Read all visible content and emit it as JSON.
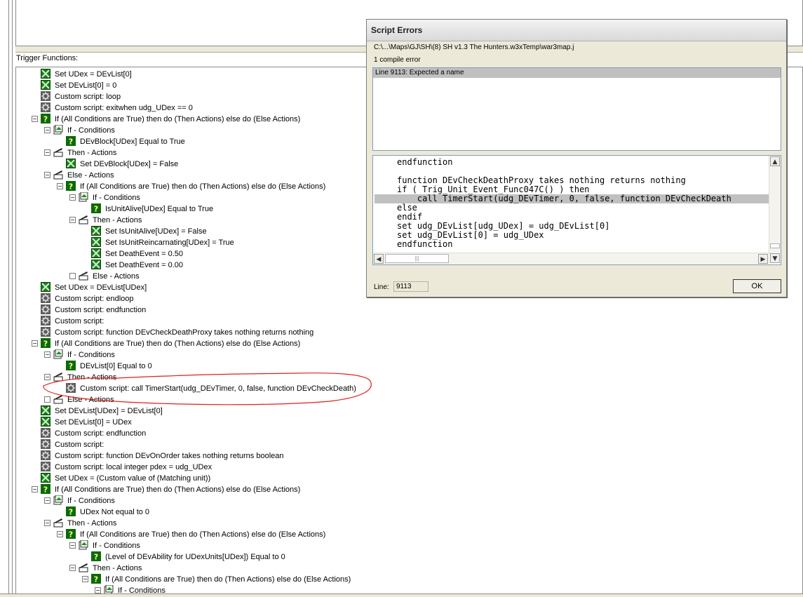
{
  "editor": {
    "trigger_functions_label": "Trigger Functions:",
    "rows": [
      {
        "text": "Set UDex = DEvList[0]",
        "icon": "set-variable-icon",
        "depth": 0,
        "exp": ""
      },
      {
        "text": "Set DEvList[0] = 0",
        "icon": "set-variable-icon",
        "depth": 0,
        "exp": ""
      },
      {
        "text": "Custom script:       loop",
        "icon": "custom-script-icon",
        "depth": 0,
        "exp": ""
      },
      {
        "text": "Custom script:           exitwhen udg_UDex == 0",
        "icon": "custom-script-icon",
        "depth": 0,
        "exp": ""
      },
      {
        "text": "If (All Conditions are True) then do (Then Actions) else do (Else Actions)",
        "icon": "if-then-else-icon",
        "depth": 0,
        "exp": "-"
      },
      {
        "text": "If - Conditions",
        "icon": "conditions-icon",
        "depth": 1,
        "exp": "-"
      },
      {
        "text": "DEvBlock[UDex] Equal to True",
        "icon": "condition-icon",
        "depth": 2,
        "exp": ""
      },
      {
        "text": "Then - Actions",
        "icon": "actions-icon",
        "depth": 1,
        "exp": "-"
      },
      {
        "text": "Set DEvBlock[UDex] = False",
        "icon": "set-variable-icon",
        "depth": 2,
        "exp": ""
      },
      {
        "text": "Else - Actions",
        "icon": "actions-icon",
        "depth": 1,
        "exp": "-"
      },
      {
        "text": "If (All Conditions are True) then do (Then Actions) else do (Else Actions)",
        "icon": "if-then-else-icon",
        "depth": 2,
        "exp": "-"
      },
      {
        "text": "If - Conditions",
        "icon": "conditions-icon",
        "depth": 3,
        "exp": "-"
      },
      {
        "text": "IsUnitAlive[UDex] Equal to True",
        "icon": "condition-icon",
        "depth": 4,
        "exp": ""
      },
      {
        "text": "Then - Actions",
        "icon": "actions-icon",
        "depth": 3,
        "exp": "-"
      },
      {
        "text": "Set IsUnitAlive[UDex] = False",
        "icon": "set-variable-icon",
        "depth": 4,
        "exp": ""
      },
      {
        "text": "Set IsUnitReincarnating[UDex] = True",
        "icon": "set-variable-icon",
        "depth": 4,
        "exp": ""
      },
      {
        "text": "Set DeathEvent = 0.50",
        "icon": "set-variable-icon",
        "depth": 4,
        "exp": ""
      },
      {
        "text": "Set DeathEvent = 0.00",
        "icon": "set-variable-icon",
        "depth": 4,
        "exp": ""
      },
      {
        "text": "Else - Actions",
        "icon": "actions-icon",
        "depth": 3,
        "exp": " "
      },
      {
        "text": "Set UDex = DEvList[UDex]",
        "icon": "set-variable-icon",
        "depth": 0,
        "exp": ""
      },
      {
        "text": "Custom script:       endloop",
        "icon": "custom-script-icon",
        "depth": 0,
        "exp": ""
      },
      {
        "text": "Custom script:   endfunction",
        "icon": "custom-script-icon",
        "depth": 0,
        "exp": ""
      },
      {
        "text": "Custom script:",
        "icon": "custom-script-icon",
        "depth": 0,
        "exp": ""
      },
      {
        "text": "Custom script:   function DEvCheckDeathProxy takes nothing returns nothing",
        "icon": "custom-script-icon",
        "depth": 0,
        "exp": ""
      },
      {
        "text": "If (All Conditions are True) then do (Then Actions) else do (Else Actions)",
        "icon": "if-then-else-icon",
        "depth": 0,
        "exp": "-"
      },
      {
        "text": "If - Conditions",
        "icon": "conditions-icon",
        "depth": 1,
        "exp": "-"
      },
      {
        "text": "DEvList[0] Equal to 0",
        "icon": "condition-icon",
        "depth": 2,
        "exp": ""
      },
      {
        "text": "Then - Actions",
        "icon": "actions-icon",
        "depth": 1,
        "exp": "-"
      },
      {
        "text": "Custom script:    call TimerStart(udg_DEvTimer, 0, false, function DEvCheckDeath)",
        "icon": "custom-script-icon",
        "depth": 2,
        "exp": ""
      },
      {
        "text": "Else - Actions",
        "icon": "actions-icon",
        "depth": 1,
        "exp": " "
      },
      {
        "text": "Set DEvList[UDex] = DEvList[0]",
        "icon": "set-variable-icon",
        "depth": 0,
        "exp": ""
      },
      {
        "text": "Set DEvList[0] = UDex",
        "icon": "set-variable-icon",
        "depth": 0,
        "exp": ""
      },
      {
        "text": "Custom script:   endfunction",
        "icon": "custom-script-icon",
        "depth": 0,
        "exp": ""
      },
      {
        "text": "Custom script:",
        "icon": "custom-script-icon",
        "depth": 0,
        "exp": ""
      },
      {
        "text": "Custom script:   function DEvOnOrder takes nothing returns boolean",
        "icon": "custom-script-icon",
        "depth": 0,
        "exp": ""
      },
      {
        "text": "Custom script:       local integer pdex = udg_UDex",
        "icon": "custom-script-icon",
        "depth": 0,
        "exp": ""
      },
      {
        "text": "Set UDex = (Custom value of (Matching unit))",
        "icon": "set-variable-icon",
        "depth": 0,
        "exp": ""
      },
      {
        "text": "If (All Conditions are True) then do (Then Actions) else do (Else Actions)",
        "icon": "if-then-else-icon",
        "depth": 0,
        "exp": "-"
      },
      {
        "text": "If - Conditions",
        "icon": "conditions-icon",
        "depth": 1,
        "exp": "-"
      },
      {
        "text": "UDex Not equal to 0",
        "icon": "condition-icon",
        "depth": 2,
        "exp": ""
      },
      {
        "text": "Then - Actions",
        "icon": "actions-icon",
        "depth": 1,
        "exp": "-"
      },
      {
        "text": "If (All Conditions are True) then do (Then Actions) else do (Else Actions)",
        "icon": "if-then-else-icon",
        "depth": 2,
        "exp": "-"
      },
      {
        "text": "If - Conditions",
        "icon": "conditions-icon",
        "depth": 3,
        "exp": "-"
      },
      {
        "text": "(Level of DEvAbility for UDexUnits[UDex]) Equal to 0",
        "icon": "condition-icon",
        "depth": 4,
        "exp": ""
      },
      {
        "text": "Then - Actions",
        "icon": "actions-icon",
        "depth": 3,
        "exp": "-"
      },
      {
        "text": "If (All Conditions are True) then do (Then Actions) else do (Else Actions)",
        "icon": "if-then-else-icon",
        "depth": 4,
        "exp": "-"
      },
      {
        "text": "If - Conditions",
        "icon": "conditions-icon",
        "depth": 5,
        "exp": "-"
      }
    ]
  },
  "dialog": {
    "title": "Script Errors",
    "path": "C:\\...\\Maps\\GJ\\SH\\(8) SH v1.3 The Hunters.w3xTemp\\war3map.j",
    "error_count": "1 compile error",
    "errors": [
      "Line 9113: Expected a name"
    ],
    "code_lines": [
      "endfunction",
      "",
      "function DEvCheckDeathProxy takes nothing returns nothing",
      "if ( Trig_Unit_Event_Func047C() ) then",
      "    call TimerStart(udg_DEvTimer, 0, false, function DEvCheckDeath",
      "else",
      "endif",
      "set udg_DEvList[udg_UDex] = udg_DEvList[0]",
      "set udg_DEvList[0] = udg_UDex",
      "endfunction"
    ],
    "highlighted_line_index": 4,
    "line_label": "Line:",
    "line_value": "9113",
    "ok_label": "OK"
  },
  "colors": {
    "set_variable": "#1f9a1f",
    "condition": "#0a7a0a",
    "custom_script": "#6a6a6a",
    "annotation": "#e0201a"
  }
}
